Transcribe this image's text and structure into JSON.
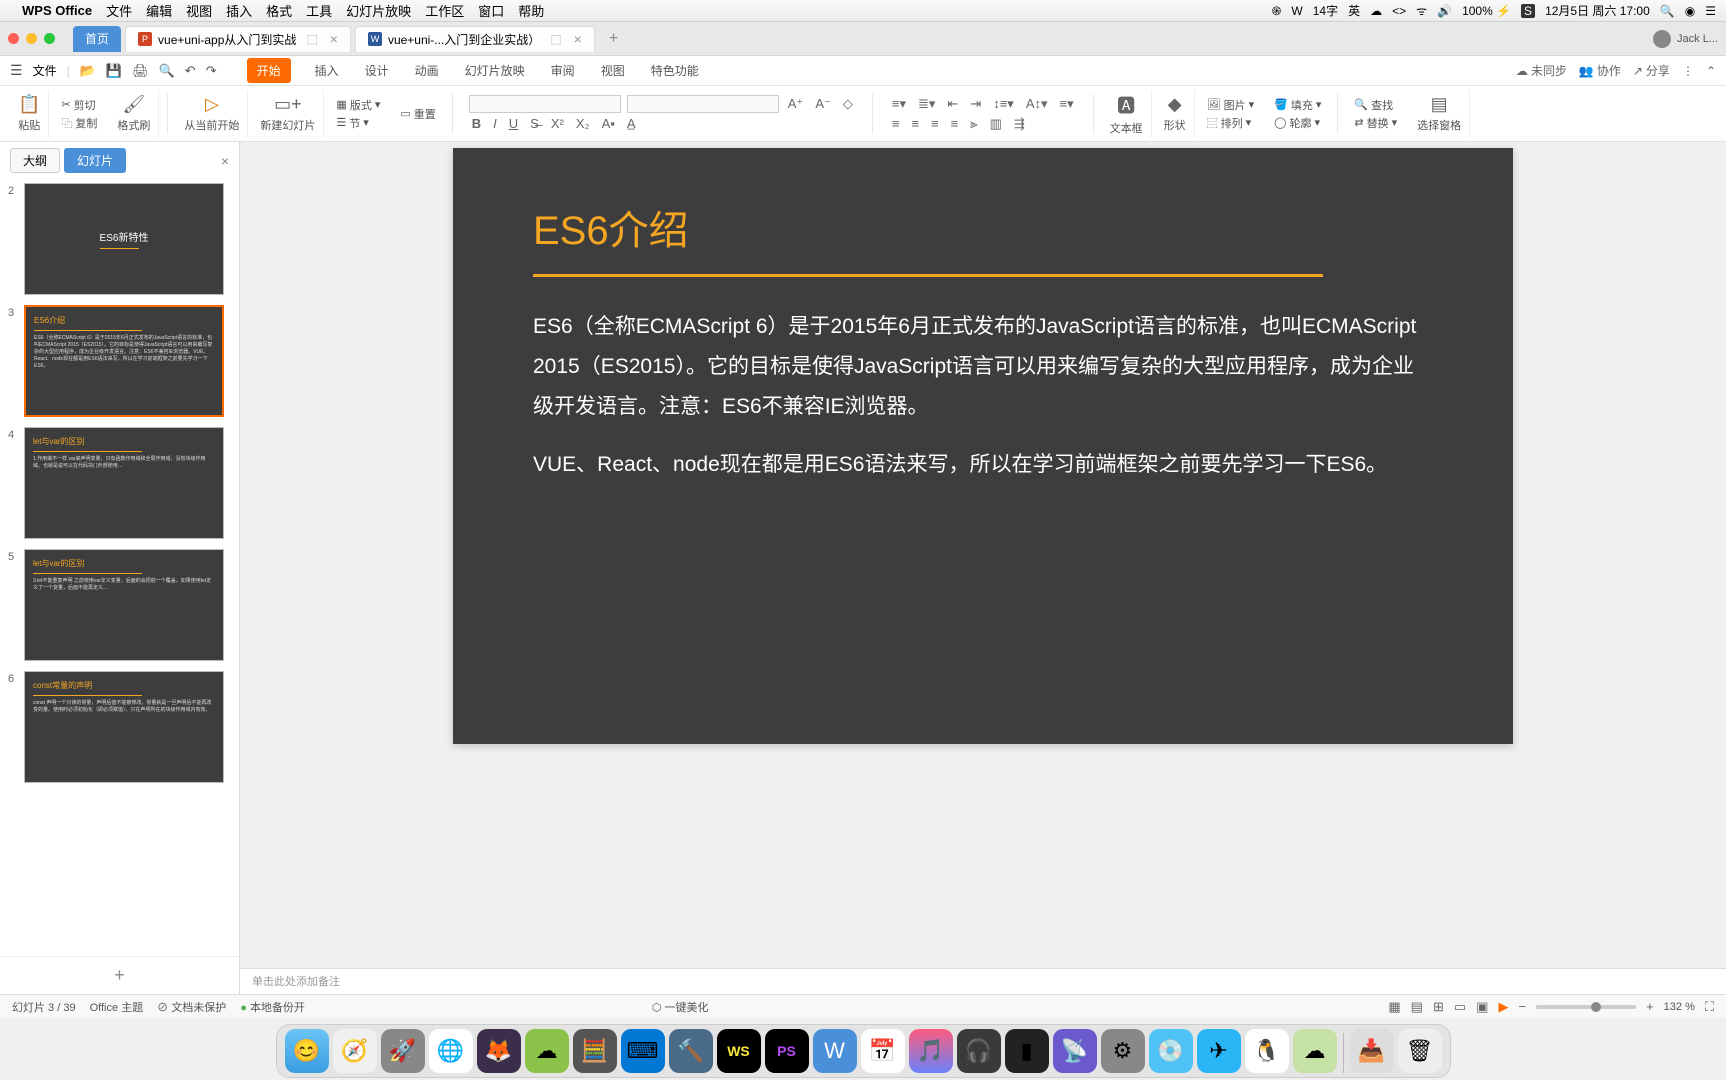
{
  "mac_menu": {
    "app": "WPS Office",
    "items": [
      "文件",
      "编辑",
      "视图",
      "插入",
      "格式",
      "工具",
      "幻灯片放映",
      "工作区",
      "窗口",
      "帮助"
    ],
    "right": {
      "input": "14字",
      "lang": "英",
      "battery": "100%",
      "date": "12月5日 周六 17:00"
    }
  },
  "tabs": {
    "home": "首页",
    "doc1": "vue+uni-app从入门到实战",
    "doc2": "vue+uni-...入门到企业实战）",
    "user": "Jack L..."
  },
  "file_row": {
    "file": "文件",
    "ribbon_tabs": [
      "开始",
      "插入",
      "设计",
      "动画",
      "幻灯片放映",
      "审阅",
      "视图",
      "特色功能"
    ],
    "unsync": "未同步",
    "collab": "协作",
    "share": "分享"
  },
  "ribbon": {
    "paste": "粘贴",
    "cut": "剪切",
    "copy": "复制",
    "format_painter": "格式刷",
    "from_current": "从当前开始",
    "new_slide": "新建幻灯片",
    "layout": "版式",
    "section": "节",
    "reset": "重置",
    "textbox": "文本框",
    "shape": "形状",
    "picture": "图片",
    "fill": "填充",
    "arrange": "排列",
    "outline": "轮廓",
    "find": "查找",
    "replace": "替换",
    "select_pane": "选择窗格"
  },
  "panel": {
    "outline": "大纲",
    "slides": "幻灯片"
  },
  "thumbs": [
    {
      "num": "2",
      "title": "ES6新特性",
      "body": ""
    },
    {
      "num": "3",
      "title": "ES6介绍",
      "body": "ES6（全称ECMAScript 6）是于2015年6月正式发布的JavaScript语言的标准，也叫ECMAScript 2015（ES2015）。它的目标是使得JavaScript语言可以用来编写复杂的大型应用程序，成为企业级开发语言。注意：ES6不兼容IE浏览器。VUE、React、node现在都是用ES6语法来写，所以在学习前端框架之前要先学习一下ES6。"
    },
    {
      "num": "4",
      "title": "let与var的区别",
      "body": "1.作用域不一样 var来声明变量，只有函数作用域和全局作用域，没有块级作用域。也就是说可以在代码块{ }外部使用…"
    },
    {
      "num": "5",
      "title": "let与var的区别",
      "body": "3.let不能重复声明 之前使用var定义变量，后面的会把前一个覆盖。如果使用let定义了一个变量，后面不能再定义…"
    },
    {
      "num": "6",
      "title": "const常量的声明",
      "body": "const 声明一个只读的常量，声明后值不能被修改。常量就是一旦声明后不能再改变的量。使用时必须初始化（即必须赋值），只在声明所在的块级作用域内有效。"
    }
  ],
  "slide": {
    "title": "ES6介绍",
    "p1": "ES6（全称ECMAScript 6）是于2015年6月正式发布的JavaScript语言的标准，也叫ECMAScript 2015（ES2015）。它的目标是使得JavaScript语言可以用来编写复杂的大型应用程序，成为企业级开发语言。注意：ES6不兼容IE浏览器。",
    "p2": "VUE、React、node现在都是用ES6语法来写，所以在学习前端框架之前要先学习一下ES6。"
  },
  "notes": "单击此处添加备注",
  "status": {
    "slide_pos": "幻灯片 3 / 39",
    "theme": "Office 主题",
    "protect": "文档未保护",
    "local": "本地备份开",
    "beautify": "一键美化",
    "zoom": "132 %"
  }
}
